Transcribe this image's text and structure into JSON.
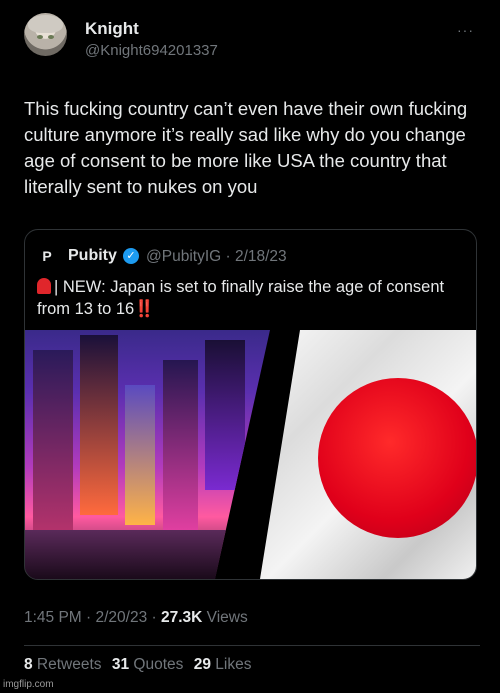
{
  "author": {
    "name": "Knight",
    "handle": "@Knight694201337",
    "more": "···"
  },
  "tweet": {
    "text": "This fucking country can’t even have their own fucking culture anymore it’s really sad like why do you change age of consent to be more like USA the country that literally sent to nukes on you"
  },
  "quote": {
    "logo": "P",
    "name": "Pubity",
    "verified": "✓",
    "handle_date": "@PubityIG · 2/18/23",
    "text": "| NEW: Japan is set to finally raise the age of consent from 13 to 16",
    "emphasis": "‼️"
  },
  "meta": {
    "time_date": "1:45 PM · 2/20/23 · ",
    "views_count": "27.3K",
    "views_label": " Views"
  },
  "stats": {
    "retweets_count": "8",
    "retweets_label": " Retweets",
    "quotes_count": "31",
    "quotes_label": " Quotes",
    "likes_count": "29",
    "likes_label": " Likes"
  },
  "watermark": "imgflip.com",
  "colors": {
    "background": "#000000",
    "text": "#e7e9ea",
    "muted": "#71767b",
    "verified": "#1d9bf0",
    "flag_red": "#e0001a"
  }
}
